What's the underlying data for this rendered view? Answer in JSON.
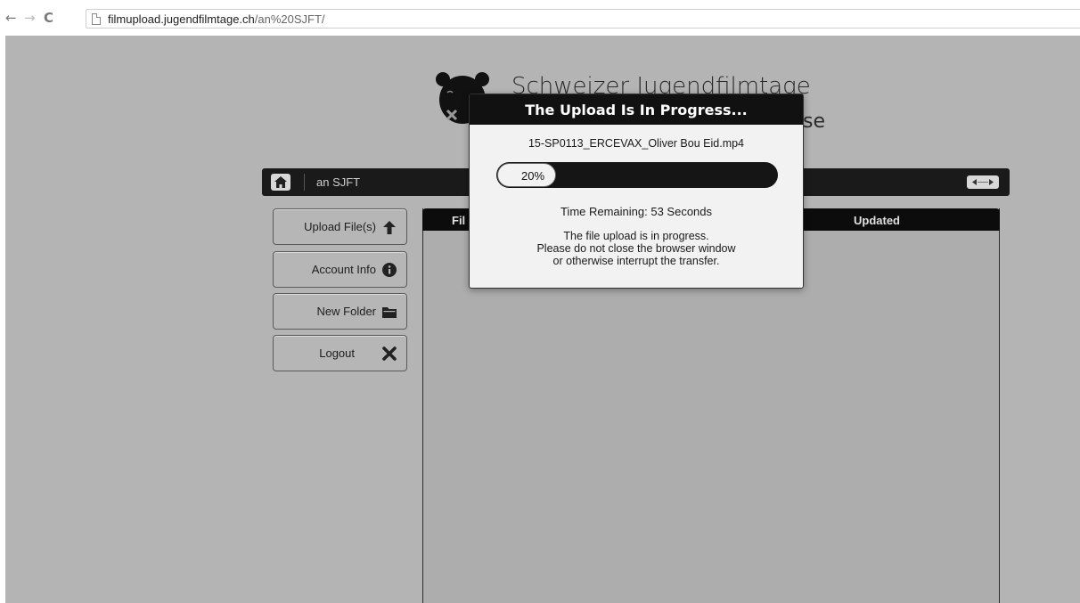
{
  "browser": {
    "nav_back": "←",
    "nav_forward": "→",
    "nav_reload": "C",
    "url_host": "filmupload.jugendfilmtage.ch",
    "url_path": "/an%20SJFT/"
  },
  "site": {
    "title": "Schweizer Jugendfilmtage",
    "subtitle_tail": "se",
    "logo_icon": "bear-head-logo"
  },
  "topbar": {
    "folder": "an SJFT",
    "home_icon": "home-icon",
    "resize_icon": "resize-arrows-icon"
  },
  "sidebar": {
    "items": [
      {
        "label": "Upload File(s)",
        "icon": "upload-arrow-icon"
      },
      {
        "label": "Account Info",
        "icon": "info-icon"
      },
      {
        "label": "New Folder",
        "icon": "folder-icon"
      },
      {
        "label": "Logout",
        "icon": "close-x-icon"
      }
    ]
  },
  "file_table": {
    "columns": [
      "Fil",
      "Updated"
    ]
  },
  "modal": {
    "title": "The Upload Is In Progress...",
    "file_name": "15-SP0113_ERCEVAX_Oliver Bou Eid.mp4",
    "progress_label": "20%",
    "progress_value": 0.2,
    "time_remaining": "Time Remaining: 53 Seconds",
    "message_lines": [
      "The file upload is in progress.",
      "Please do not close the browser window",
      "or otherwise interrupt the transfer."
    ]
  }
}
